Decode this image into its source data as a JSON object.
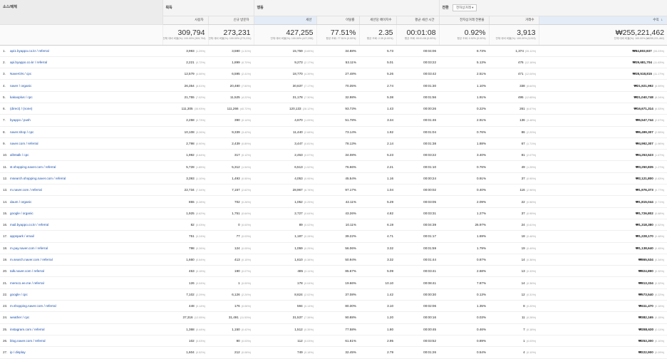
{
  "header": {
    "dimension_label": "소스/매체",
    "group_acquisition": "획득",
    "group_behavior": "행동",
    "group_conversion": "전환",
    "conversion_select": "전자상거래",
    "columns": [
      "사용자",
      "신규 방문자",
      "세션",
      "이탈률",
      "세션당 페이지수",
      "평균 세션 시간",
      "전자상거래 전환율",
      "거래수",
      "수익"
    ]
  },
  "totals": {
    "users": "309,794",
    "users_sub": "전체 대비 비율(%): 100.00% (309,794)",
    "new_users": "273,231",
    "new_users_sub": "전체 대비 비율(%): 100.00% (273,231)",
    "sessions": "427,255",
    "sessions_sub": "전체 대비 비율(%): 100.00% (427,255)",
    "bounce": "77.51%",
    "bounce_sub": "평균 조회: 77.51% (0.00%)",
    "pages": "2.35",
    "pages_sub": "평균 조회: 2.35 (0.00%)",
    "duration": "00:01:08",
    "duration_sub": "평균 조회: 00:01:08 (0.00%)",
    "conv": "0.92%",
    "conv_sub": "평균 조회: 0.92% (0.00%)",
    "trans": "3,913",
    "trans_sub": "전체 대비 비율(%): 100.00% (3,913)",
    "revenue": "₩255,221,462",
    "revenue_sub": "전체 대비 비율(%): 100.00% (₩255,221,462)"
  },
  "rows": [
    {
      "n": "1.",
      "name": "api1.byappo.co.kr / referral",
      "u": "3,993",
      "up": "(1.29%)",
      "nu": "3,590",
      "nup": "(1.31%)",
      "s": "15,759",
      "sp": "(3.69%)",
      "b": "34.88%",
      "p": "5.73",
      "d": "00:04:06",
      "c": "8.73%",
      "t": "1,374",
      "tp": "(35.11%)",
      "r": "₩84,803,937",
      "rp": "(33.23%)"
    },
    {
      "n": "2.",
      "name": "api.byappo.co.kr / referral",
      "u": "2,221",
      "up": "(0.72%)",
      "nu": "1,899",
      "nup": "(0.70%)",
      "s": "9,273",
      "sp": "(2.17%)",
      "b": "53.11%",
      "p": "5.01",
      "d": "00:03:22",
      "c": "5.13%",
      "t": "476",
      "tp": "(12.16%)",
      "r": "₩29,681,704",
      "rp": "(11.63%)"
    },
    {
      "n": "3.",
      "name": "NaverGN / cpc",
      "u": "12,579",
      "up": "(4.06%)",
      "nu": "6,595",
      "nup": "(2.41%)",
      "s": "18,770",
      "sp": "(4.39%)",
      "b": "27.48%",
      "p": "5.26",
      "d": "00:03:42",
      "c": "2.51%",
      "t": "471",
      "tp": "(12.04%)",
      "r": "₩28,518,815",
      "rp": "(11.17%)"
    },
    {
      "n": "4.",
      "name": "naver / organic",
      "u": "26,354",
      "up": "(8.51%)",
      "nu": "20,480",
      "nup": "(7.50%)",
      "s": "30,637",
      "sp": "(7.17%)",
      "b": "70.35%",
      "p": "2.74",
      "d": "00:01:30",
      "c": "1.10%",
      "t": "338",
      "tp": "(8.64%)",
      "r": "₩21,921,992",
      "rp": "(8.59%)"
    },
    {
      "n": "5.",
      "name": "kakaoplus / cpc",
      "u": "21,755",
      "up": "(7.02%)",
      "nu": "11,525",
      "nup": "(4.22%)",
      "s": "31,178",
      "sp": "(7.30%)",
      "b": "32.98%",
      "p": "5.38",
      "d": "00:01:56",
      "c": "1.91%",
      "t": "495",
      "tp": "(12.65%)",
      "r": "₩21,040,748",
      "rp": "(8.24%)"
    },
    {
      "n": "6.",
      "name": "(direct) / (none)",
      "u": "111,305",
      "up": "(35.93%)",
      "nu": "111,266",
      "nup": "(40.72%)",
      "s": "120,133",
      "sp": "(28.12%)",
      "b": "93.73%",
      "p": "1.43",
      "d": "00:00:26",
      "c": "0.22%",
      "t": "261",
      "tp": "(6.67%)",
      "r": "₩16,671,314",
      "rp": "(6.53%)"
    },
    {
      "n": "7.",
      "name": "byappo / push",
      "u": "2,258",
      "up": "(0.73%)",
      "nu": "390",
      "nup": "(0.14%)",
      "s": "4,670",
      "sp": "(1.09%)",
      "b": "51.78%",
      "p": "3.34",
      "d": "00:01:46",
      "c": "2.91%",
      "t": "136",
      "tp": "(3.48%)",
      "r": "₩6,547,744",
      "rp": "(2.57%)"
    },
    {
      "n": "8.",
      "name": "naver.shop / cpc",
      "u": "10,108",
      "up": "(3.26%)",
      "nu": "9,339",
      "nup": "(3.42%)",
      "s": "11,440",
      "sp": "(2.68%)",
      "b": "73.14%",
      "p": "1.92",
      "d": "00:01:04",
      "c": "0.76%",
      "t": "86",
      "tp": "(2.20%)",
      "r": "₩6,499,307",
      "rp": "(2.55%)"
    },
    {
      "n": "9.",
      "name": "naver.com / referral",
      "u": "2,798",
      "up": "(0.90%)",
      "nu": "2,439",
      "nup": "(0.89%)",
      "s": "3,447",
      "sp": "(0.81%)",
      "b": "78.13%",
      "p": "2.14",
      "d": "00:01:38",
      "c": "1.88%",
      "t": "67",
      "tp": "(1.71%)",
      "r": "₩4,992,307",
      "rp": "(1.96%)"
    },
    {
      "n": "10.",
      "name": "allmtalk / cpc",
      "u": "1,992",
      "up": "(0.64%)",
      "nu": "317",
      "nup": "(0.12%)",
      "s": "2,453",
      "sp": "(0.57%)",
      "b": "34.08%",
      "p": "5.23",
      "d": "00:03:22",
      "c": "3.40%",
      "t": "81",
      "tp": "(2.07%)",
      "r": "₩4,253,523",
      "rp": "(1.67%)"
    },
    {
      "n": "11.",
      "name": "st.shopping.naver.com / referral",
      "u": "5,728",
      "up": "(1.85%)",
      "nu": "5,312",
      "nup": "(1.94%)",
      "s": "6,513",
      "sp": "(1.52%)",
      "b": "76.66%",
      "p": "2.21",
      "d": "00:01:10",
      "c": "0.76%",
      "t": "49",
      "tp": "(1.25%)",
      "r": "₩3,250,835",
      "rp": "(1.27%)"
    },
    {
      "n": "12.",
      "name": "msearch.shopping.naver.com / referral",
      "u": "3,393",
      "up": "(1.10%)",
      "nu": "1,493",
      "nup": "(0.55%)",
      "s": "4,053",
      "sp": "(0.95%)",
      "b": "45.54%",
      "p": "1.16",
      "d": "00:00:24",
      "c": "0.91%",
      "t": "37",
      "tp": "(0.95%)",
      "r": "₩2,121,800",
      "rp": "(0.83%)"
    },
    {
      "n": "13.",
      "name": "m.naver.com / referral",
      "u": "22,734",
      "up": "(7.34%)",
      "nu": "7,157",
      "nup": "(2.62%)",
      "s": "28,967",
      "sp": "(6.78%)",
      "b": "97.17%",
      "p": "1.04",
      "d": "00:00:02",
      "c": "0.40%",
      "t": "116",
      "tp": "(2.96%)",
      "r": "₩1,976,373",
      "rp": "(0.77%)"
    },
    {
      "n": "14.",
      "name": "daum / organic",
      "u": "855",
      "up": "(0.28%)",
      "nu": "702",
      "nup": "(0.26%)",
      "s": "1,052",
      "sp": "(0.25%)",
      "b": "42.11%",
      "p": "5.29",
      "d": "00:03:05",
      "c": "2.09%",
      "t": "22",
      "tp": "(0.56%)",
      "r": "₩1,815,044",
      "rp": "(0.71%)"
    },
    {
      "n": "15.",
      "name": "google / organic",
      "u": "1,925",
      "up": "(0.62%)",
      "nu": "1,751",
      "nup": "(0.64%)",
      "s": "2,727",
      "sp": "(0.64%)",
      "b": "43.26%",
      "p": "4.82",
      "d": "00:03:31",
      "c": "1.27%",
      "t": "37",
      "tp": "(0.95%)",
      "r": "₩1,726,802",
      "rp": "(0.68%)"
    },
    {
      "n": "16.",
      "name": "mail.byappo.co.kr / referral",
      "u": "82",
      "up": "(0.03%)",
      "nu": "0",
      "nup": "(0.00%)",
      "s": "89",
      "sp": "(0.02%)",
      "b": "10.11%",
      "p": "6.19",
      "d": "00:04:39",
      "c": "26.97%",
      "t": "24",
      "tp": "(0.61%)",
      "r": "₩1,318,380",
      "rp": "(0.52%)"
    },
    {
      "n": "17.",
      "name": "appspark / email",
      "u": "751",
      "up": "(0.24%)",
      "nu": "77",
      "nup": "(0.03%)",
      "s": "1,187",
      "sp": "(0.28%)",
      "b": "39.22%",
      "p": "4.71",
      "d": "00:01:17",
      "c": "1.69%",
      "t": "18",
      "tp": "(0.46%)",
      "r": "₩1,228,170",
      "rp": "(0.48%)"
    },
    {
      "n": "18.",
      "name": "m.pay.naver.com / referral",
      "u": "798",
      "up": "(0.26%)",
      "nu": "124",
      "nup": "(0.05%)",
      "s": "1,059",
      "sp": "(0.25%)",
      "b": "56.06%",
      "p": "3.32",
      "d": "00:01:59",
      "c": "1.79%",
      "t": "19",
      "tp": "(0.49%)",
      "r": "₩1,138,640",
      "rp": "(0.45%)"
    },
    {
      "n": "19.",
      "name": "m.search.naver.com / referral",
      "u": "1,660",
      "up": "(0.54%)",
      "nu": "413",
      "nup": "(0.15%)",
      "s": "1,610",
      "sp": "(0.38%)",
      "b": "50.94%",
      "p": "3.32",
      "d": "00:01:44",
      "c": "0.87%",
      "t": "14",
      "tp": "(0.36%)",
      "r": "₩865,534",
      "rp": "(0.34%)"
    },
    {
      "n": "20.",
      "name": "talk.naver.com / referral",
      "u": "453",
      "up": "(0.15%)",
      "nu": "190",
      "nup": "(0.07%)",
      "s": "485",
      "sp": "(0.11%)",
      "b": "85.67%",
      "p": "5.09",
      "d": "00:03:41",
      "c": "2.68%",
      "t": "13",
      "tp": "(0.33%)",
      "r": "₩824,890",
      "rp": "(0.32%)"
    },
    {
      "n": "21.",
      "name": "memo1.ee.me / referral",
      "u": "126",
      "up": "(0.04%)",
      "nu": "1",
      "nup": "(0.00%)",
      "s": "178",
      "sp": "(0.04%)",
      "b": "19.66%",
      "p": "10.10",
      "d": "00:08:41",
      "c": "7.87%",
      "t": "14",
      "tp": "(0.36%)",
      "r": "₩813,334",
      "rp": "(0.32%)"
    },
    {
      "n": "22.",
      "name": "google / cpc",
      "u": "7,102",
      "up": "(2.29%)",
      "nu": "6,126",
      "nup": "(2.24%)",
      "s": "8,624",
      "sp": "(2.02%)",
      "b": "37.08%",
      "p": "1.42",
      "d": "00:00:30",
      "c": "0.13%",
      "t": "12",
      "tp": "(0.31%)",
      "r": "₩573,540",
      "rp": "(0.22%)"
    },
    {
      "n": "23.",
      "name": "m.shopping.naver.com / referral",
      "u": "448",
      "up": "(0.14%)",
      "nu": "176",
      "nup": "(0.06%)",
      "s": "594",
      "sp": "(0.14%)",
      "b": "80.30%",
      "p": "3.10",
      "d": "00:02:06",
      "c": "1.35%",
      "t": "8",
      "tp": "(0.20%)",
      "r": "₩411,470",
      "rp": "(0.16%)"
    },
    {
      "n": "24.",
      "name": "weather / cpc",
      "u": "37,316",
      "up": "(12.05%)",
      "nu": "31,491",
      "nup": "(11.53%)",
      "s": "31,537",
      "sp": "(7.38%)",
      "b": "90.88%",
      "p": "1.20",
      "d": "00:00:16",
      "c": "0.03%",
      "t": "11",
      "tp": "(0.28%)",
      "r": "₩382,165",
      "rp": "(0.15%)"
    },
    {
      "n": "25.",
      "name": "instagram.com / referral",
      "u": "1,368",
      "up": "(0.44%)",
      "nu": "1,150",
      "nup": "(0.42%)",
      "s": "1,512",
      "sp": "(0.35%)",
      "b": "77.58%",
      "p": "1.80",
      "d": "00:00:45",
      "c": "0.46%",
      "t": "7",
      "tp": "(0.18%)",
      "r": "₩288,630",
      "rp": "(0.11%)"
    },
    {
      "n": "26.",
      "name": "blog.naver.com / referral",
      "u": "102",
      "up": "(0.03%)",
      "nu": "90",
      "nup": "(0.03%)",
      "s": "112",
      "sp": "(0.03%)",
      "b": "61.61%",
      "p": "2.95",
      "d": "00:03:52",
      "c": "0.89%",
      "t": "1",
      "tp": "(0.03%)",
      "r": "₩253,300",
      "rp": "(0.10%)"
    },
    {
      "n": "27.",
      "name": "ip / display",
      "u": "1,604",
      "up": "(0.52%)",
      "nu": "212",
      "nup": "(0.08%)",
      "s": "749",
      "sp": "(0.18%)",
      "b": "32.45%",
      "p": "2.79",
      "d": "00:01:26",
      "c": "0.54%",
      "t": "4",
      "tp": "(0.10%)",
      "r": "₩222,900",
      "rp": "(0.09%)"
    }
  ]
}
